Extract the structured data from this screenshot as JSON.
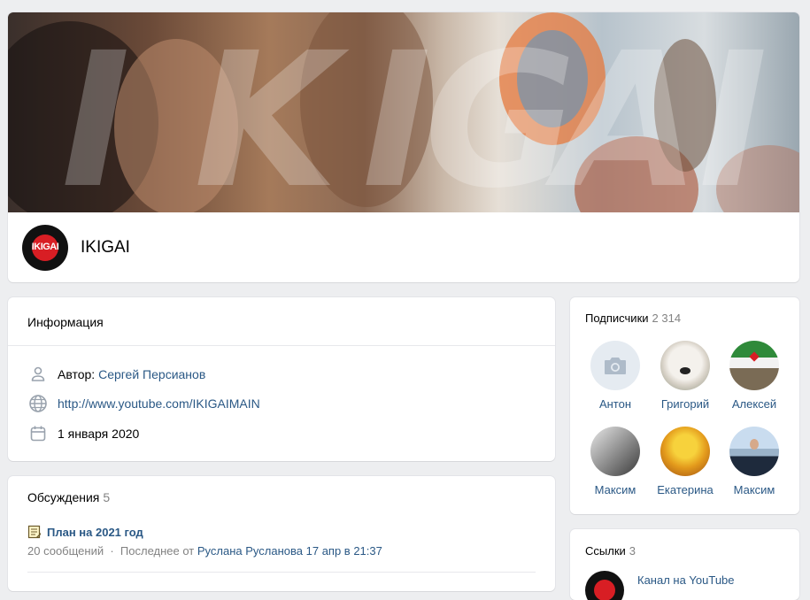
{
  "community": {
    "name": "IKIGAI",
    "logo_text": "IKIGAI",
    "cover_letters": [
      "I",
      "K",
      "I",
      "G",
      "A",
      "I"
    ]
  },
  "info": {
    "title": "Информация",
    "author_label": "Автор:",
    "author_name": "Сергей Персианов",
    "website": "http://www.youtube.com/IKIGAIMAIN",
    "date": "1 января 2020"
  },
  "discussions": {
    "title": "Обсуждения",
    "count": "5",
    "topic": {
      "title": "План на 2021 год",
      "messages": "20 сообщений",
      "separator": "·",
      "last_prefix": "Последнее от",
      "last_author": "Руслана Русланова",
      "last_time": "17 апр в 21:37"
    }
  },
  "subscribers": {
    "title": "Подписчики",
    "count": "2 314",
    "members": [
      {
        "name": "Антон"
      },
      {
        "name": "Григорий"
      },
      {
        "name": "Алексей"
      },
      {
        "name": "Максим"
      },
      {
        "name": "Екатерина"
      },
      {
        "name": "Максим"
      }
    ]
  },
  "links": {
    "title": "Ссылки",
    "count": "3",
    "items": [
      {
        "title": "Канал на YouTube"
      }
    ]
  },
  "colors": {
    "link": "#2a5885",
    "muted": "#828282",
    "background": "#edeef0",
    "logo_red": "#d81e24"
  },
  "icons": {
    "author": "user-icon",
    "website": "globe-icon",
    "date": "calendar-icon",
    "topic": "notepad-icon",
    "no_photo": "camera-icon"
  }
}
